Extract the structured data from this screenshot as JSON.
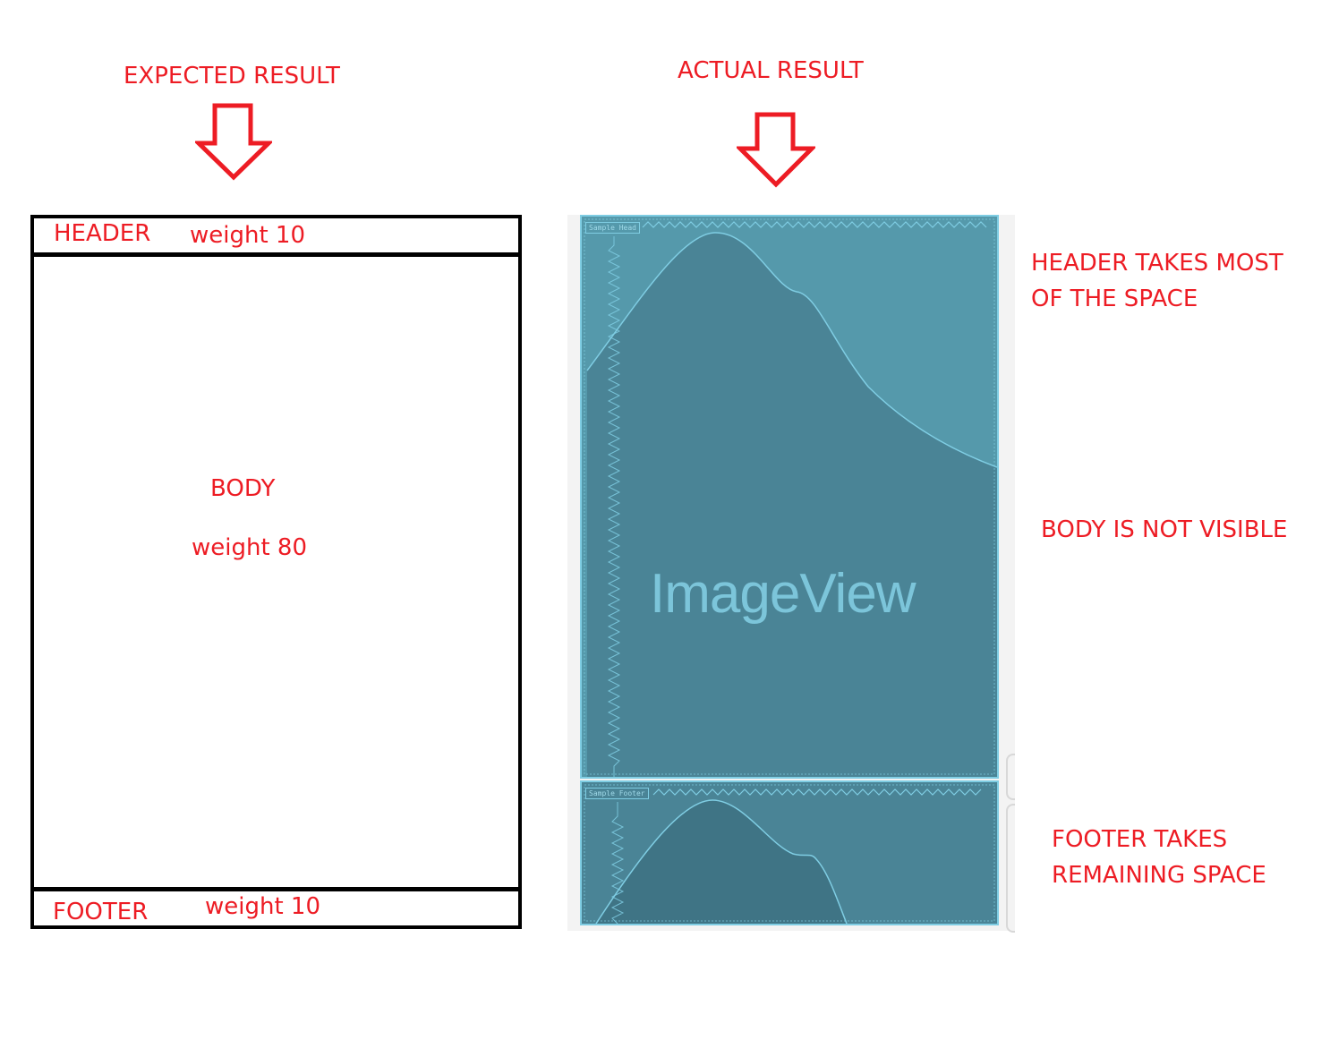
{
  "expected": {
    "title": "EXPECTED RESULT",
    "arrow_icon": "down-arrow-outline",
    "header": {
      "label": "HEADER",
      "weight": "weight 10"
    },
    "body": {
      "label": "BODY",
      "weight": "weight 80"
    },
    "footer": {
      "label": "FOOTER",
      "weight": "weight 10"
    }
  },
  "actual": {
    "title": "ACTUAL RESULT",
    "arrow_icon": "down-arrow-outline",
    "placeholder_text": "ImageView",
    "header_tag": "Sample Head",
    "footer_tag": "Sample Footer",
    "colors": {
      "panel": "#5599ab",
      "wave_fill": "#4a8496",
      "outline": "#7fcde3",
      "annotation": "#ed1c24"
    }
  },
  "annotations": {
    "header_note": [
      "HEADER TAKES MOST",
      "OF THE SPACE"
    ],
    "body_note": "BODY IS NOT VISIBLE",
    "footer_note": [
      "FOOTER TAKES",
      "REMAINING SPACE"
    ]
  }
}
